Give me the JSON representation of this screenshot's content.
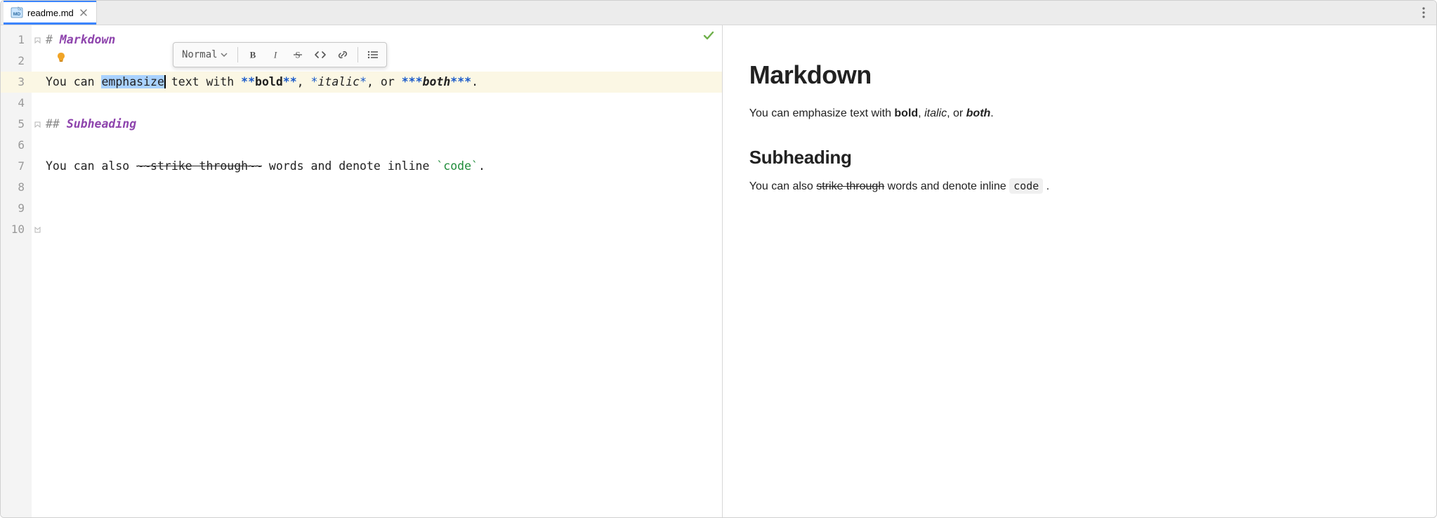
{
  "tab": {
    "filename": "readme.md",
    "file_ext_badge": "MD"
  },
  "toolbar": {
    "style_label": "Normal"
  },
  "editor": {
    "line_numbers": [
      "1",
      "2",
      "3",
      "4",
      "5",
      "6",
      "7",
      "8",
      "9",
      "10"
    ],
    "highlighted_line_index": 2,
    "lines": {
      "l1": {
        "prefix": "# ",
        "heading": "Markdown"
      },
      "l3": {
        "t1": "You can ",
        "sel": "emphasize",
        "t2": " text with ",
        "s1": "**",
        "b": "bold",
        "s1b": "**",
        "c1": ", ",
        "s2": "*",
        "i": "italic",
        "s2b": "*",
        "c2": ", or ",
        "s3": "***",
        "bi": "both",
        "s3b": "***",
        "dot": "."
      },
      "l5": {
        "prefix": "## ",
        "heading": "Subheading"
      },
      "l7": {
        "t1": "You can also ",
        "td": "~~",
        "st": "strike through",
        "tdb": "~~",
        "t2": " words and denote inline ",
        "tk": "`",
        "code": "code",
        "tkb": "`",
        "dot": "."
      }
    }
  },
  "preview": {
    "h1": "Markdown",
    "p1": {
      "a": "You can emphasize text with ",
      "b": "bold",
      "c": ", ",
      "d": "italic",
      "e": ", or ",
      "f": "both",
      "g": "."
    },
    "h2": "Subheading",
    "p2": {
      "a": "You can also ",
      "b": "strike through",
      "c": " words and denote inline ",
      "d": "code",
      "e": " ."
    }
  }
}
